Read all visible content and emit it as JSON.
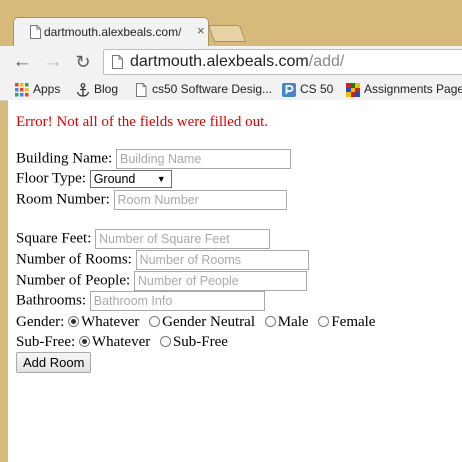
{
  "browser": {
    "tab": {
      "title": "dartmouth.alexbeals.com/",
      "close": "×"
    },
    "nav": {
      "back": "←",
      "forward": "→",
      "reload": "↻"
    },
    "url": {
      "host": "dartmouth.alexbeals.com",
      "path": "/add/"
    },
    "bookmarks": [
      {
        "label": "Apps",
        "icon": "apps-grid-icon"
      },
      {
        "label": "Blog",
        "icon": "anchor-icon"
      },
      {
        "label": "cs50 Software Desig...",
        "icon": "page-icon"
      },
      {
        "label": "CS 50",
        "icon": "p-logo-icon"
      },
      {
        "label": "Assignments Page",
        "icon": "mosaic-icon"
      }
    ]
  },
  "form": {
    "error": "Error! Not all of the fields were filled out.",
    "building_name": {
      "label": "Building Name:",
      "placeholder": "Building Name"
    },
    "floor_type": {
      "label": "Floor Type:",
      "selected": "Ground"
    },
    "room_number": {
      "label": "Room Number:",
      "placeholder": "Room Number"
    },
    "square_feet": {
      "label": "Square Feet:",
      "placeholder": "Number of Square Feet"
    },
    "num_rooms": {
      "label": "Number of Rooms:",
      "placeholder": "Number of Rooms"
    },
    "num_people": {
      "label": "Number of People:",
      "placeholder": "Number of People"
    },
    "bathrooms": {
      "label": "Bathrooms:",
      "placeholder": "Bathroom Info"
    },
    "gender": {
      "label": "Gender:",
      "options": [
        "Whatever",
        "Gender Neutral",
        "Male",
        "Female"
      ],
      "selected": "Whatever"
    },
    "sub_free": {
      "label": "Sub-Free:",
      "options": [
        "Whatever",
        "Sub-Free"
      ],
      "selected": "Whatever"
    },
    "submit": "Add Room"
  },
  "colors": {
    "error": "#e00000",
    "frame": "#d7b97a",
    "chrome": "#f2f2f2"
  }
}
